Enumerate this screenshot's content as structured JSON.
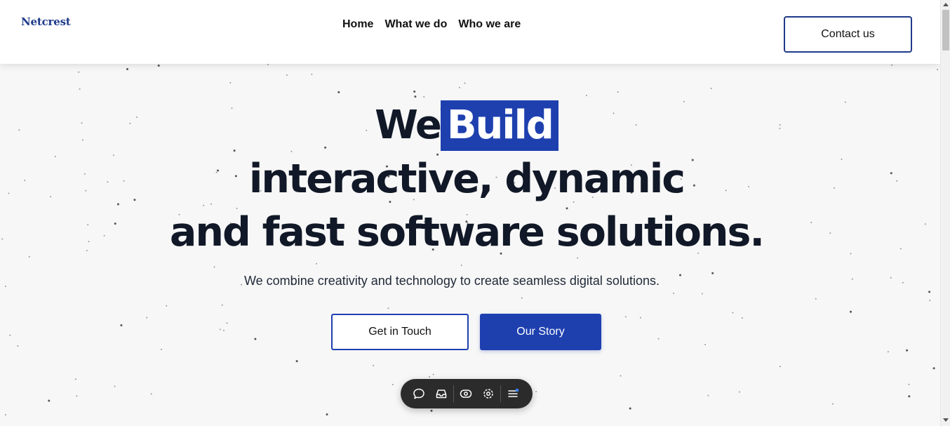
{
  "header": {
    "logo": "Netcrest",
    "nav": [
      {
        "label": "Home"
      },
      {
        "label": "What we do"
      },
      {
        "label": "Who we are"
      }
    ],
    "contact_label": "Contact us"
  },
  "hero": {
    "word1": "We",
    "highlight": "Build",
    "line2": "interactive, dynamic",
    "line3": "and fast software solutions.",
    "subtitle": "We combine creativity and technology to create seamless digital solutions.",
    "primary_cta": "Get in Touch",
    "secondary_cta": "Our Story"
  },
  "toolbar": {
    "icons": [
      "comment-icon",
      "inbox-icon",
      "eye-icon",
      "settings-icon",
      "menu-icon"
    ]
  },
  "colors": {
    "accent": "#1e40af",
    "logo": "#1e3a8a",
    "text": "#111827",
    "background": "#f7f7f7",
    "toolbar_bg": "#2b2b2b"
  }
}
